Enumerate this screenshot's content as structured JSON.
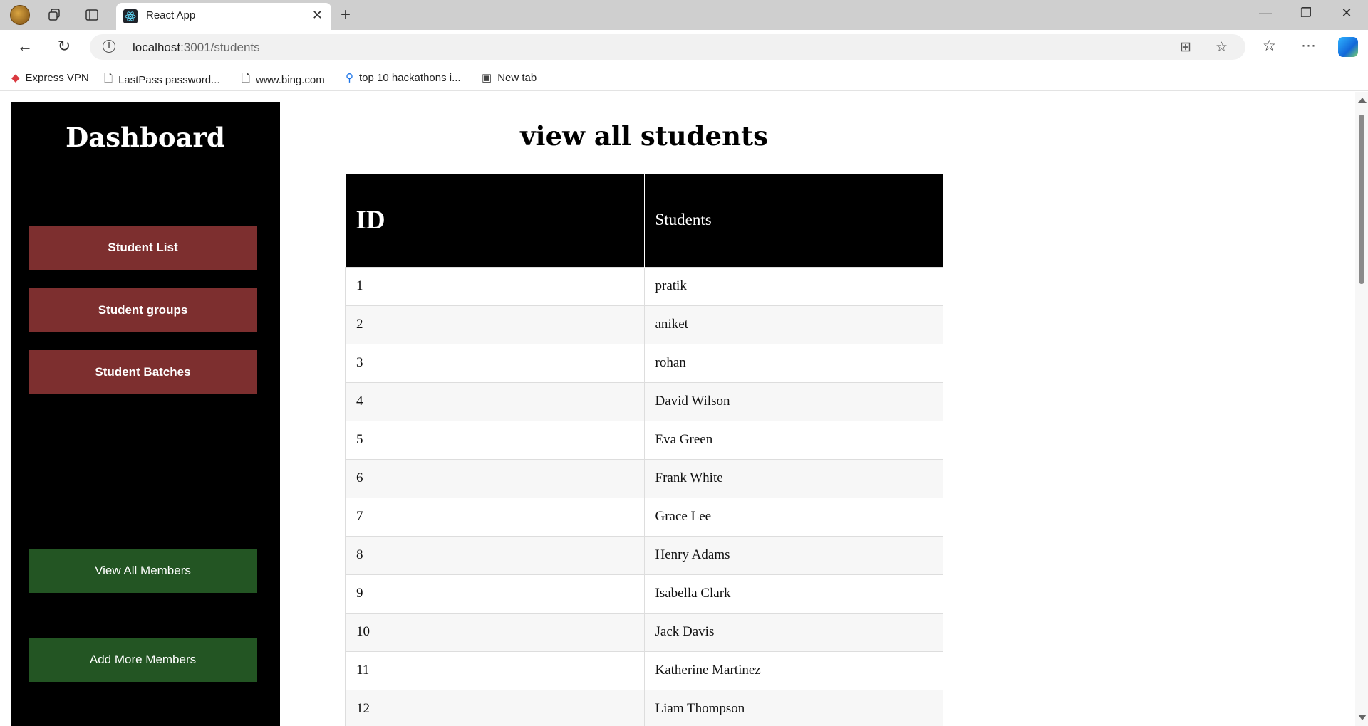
{
  "browser": {
    "tab_title": "React App",
    "url_host": "localhost",
    "url_path": ":3001/students",
    "bookmarks": [
      {
        "label": "Express VPN"
      },
      {
        "label": "LastPass password..."
      },
      {
        "label": "www.bing.com"
      },
      {
        "label": "top 10 hackathons i..."
      },
      {
        "label": "New tab"
      }
    ]
  },
  "sidebar": {
    "title": "Dashboard",
    "buttons": [
      "Student List",
      "Student groups",
      "Student Batches"
    ],
    "member_buttons": [
      "View All Members",
      "Add More Members"
    ]
  },
  "main": {
    "title": "view all students",
    "columns": [
      "ID",
      "Students"
    ],
    "rows": [
      [
        "1",
        "pratik"
      ],
      [
        "2",
        "aniket"
      ],
      [
        "3",
        "rohan"
      ],
      [
        "4",
        "David Wilson"
      ],
      [
        "5",
        "Eva Green"
      ],
      [
        "6",
        "Frank White"
      ],
      [
        "7",
        "Grace Lee"
      ],
      [
        "8",
        "Henry Adams"
      ],
      [
        "9",
        "Isabella Clark"
      ],
      [
        "10",
        "Jack Davis"
      ],
      [
        "11",
        "Katherine Martinez"
      ],
      [
        "12",
        "Liam Thompson"
      ]
    ]
  },
  "colors": {
    "sidebar_bg": "#000000",
    "nav_button": "#7d2f2f",
    "member_button": "#235523"
  }
}
